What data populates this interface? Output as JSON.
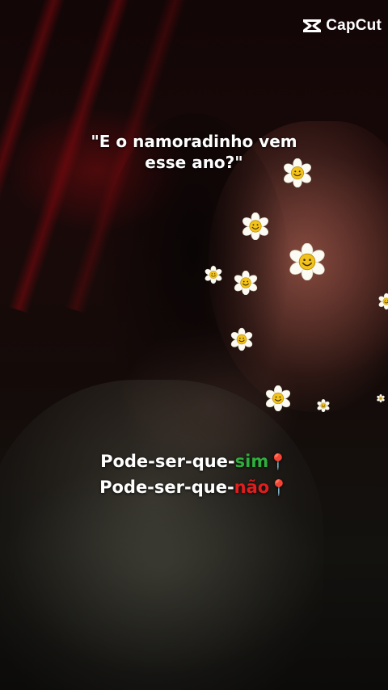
{
  "watermark": {
    "brand": "CapCut",
    "icon": "capcut-logo-icon"
  },
  "caption": {
    "line1": "\"E o namoradinho vem",
    "line2": "esse ano?\""
  },
  "answers": [
    {
      "prefix": "Pode-ser-que-",
      "word": "sim",
      "word_color": "#2fae3e",
      "emoji": "📍"
    },
    {
      "prefix": "Pode-ser-que-",
      "word": "não",
      "word_color": "#e31d1d",
      "emoji": "📍"
    }
  ],
  "stickers": {
    "icon": "smiley-daisy-icon",
    "count": 12
  }
}
